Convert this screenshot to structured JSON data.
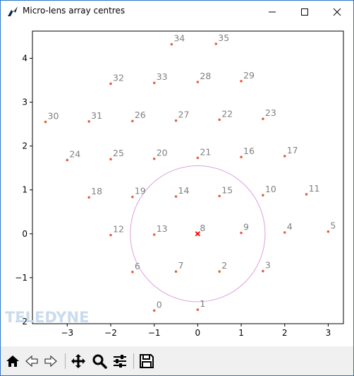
{
  "window": {
    "title": "Micro-lens array centres",
    "controls": [
      "minimize",
      "maximize",
      "close"
    ]
  },
  "watermark": "TELEDYNE",
  "toolbar": {
    "tools": [
      "home-icon",
      "back-arrow-icon",
      "forward-arrow-icon",
      "pan-icon",
      "zoom-icon",
      "configure-subplots-icon",
      "save-icon"
    ]
  },
  "colors": {
    "points": "#e8603c",
    "labels": "#808080",
    "circle": "#dda0dd",
    "centre_marker": "#ff0000"
  },
  "chart_data": {
    "type": "scatter",
    "title": "",
    "xlabel": "",
    "ylabel": "",
    "xlim": [
      -3.8,
      3.35
    ],
    "ylim": [
      -2.05,
      4.62
    ],
    "xticks": [
      -3,
      -2,
      -1,
      0,
      1,
      2,
      3
    ],
    "yticks": [
      -2,
      -1,
      0,
      1,
      2,
      3,
      4
    ],
    "grid": false,
    "points": [
      {
        "label": "0",
        "x": -1.0,
        "y": -1.75
      },
      {
        "label": "1",
        "x": 0.0,
        "y": -1.73
      },
      {
        "label": "2",
        "x": 0.5,
        "y": -0.86
      },
      {
        "label": "3",
        "x": 1.5,
        "y": -0.85
      },
      {
        "label": "4",
        "x": 2.0,
        "y": 0.03
      },
      {
        "label": "5",
        "x": 3.0,
        "y": 0.05
      },
      {
        "label": "6",
        "x": -1.5,
        "y": -0.87
      },
      {
        "label": "7",
        "x": -0.5,
        "y": -0.86
      },
      {
        "label": "8",
        "x": 0.0,
        "y": 0.0
      },
      {
        "label": "9",
        "x": 1.0,
        "y": 0.02
      },
      {
        "label": "10",
        "x": 1.5,
        "y": 0.88
      },
      {
        "label": "11",
        "x": 2.5,
        "y": 0.9
      },
      {
        "label": "12",
        "x": -2.0,
        "y": -0.03
      },
      {
        "label": "13",
        "x": -1.0,
        "y": -0.02
      },
      {
        "label": "14",
        "x": -0.5,
        "y": 0.85
      },
      {
        "label": "15",
        "x": 0.5,
        "y": 0.86
      },
      {
        "label": "16",
        "x": 1.0,
        "y": 1.75
      },
      {
        "label": "17",
        "x": 2.0,
        "y": 1.77
      },
      {
        "label": "18",
        "x": -2.5,
        "y": 0.83
      },
      {
        "label": "19",
        "x": -1.5,
        "y": 0.84
      },
      {
        "label": "20",
        "x": -1.0,
        "y": 1.71
      },
      {
        "label": "21",
        "x": 0.0,
        "y": 1.73
      },
      {
        "label": "22",
        "x": 0.5,
        "y": 2.6
      },
      {
        "label": "23",
        "x": 1.5,
        "y": 2.62
      },
      {
        "label": "24",
        "x": -3.0,
        "y": 1.68
      },
      {
        "label": "25",
        "x": -2.0,
        "y": 1.7
      },
      {
        "label": "26",
        "x": -1.5,
        "y": 2.57
      },
      {
        "label": "27",
        "x": -0.5,
        "y": 2.58
      },
      {
        "label": "28",
        "x": 0.0,
        "y": 3.46
      },
      {
        "label": "29",
        "x": 1.0,
        "y": 3.48
      },
      {
        "label": "30",
        "x": -3.5,
        "y": 2.55
      },
      {
        "label": "31",
        "x": -2.5,
        "y": 2.56
      },
      {
        "label": "32",
        "x": -2.0,
        "y": 3.42
      },
      {
        "label": "33",
        "x": -1.0,
        "y": 3.44
      },
      {
        "label": "34",
        "x": -0.6,
        "y": 4.32
      },
      {
        "label": "35",
        "x": 0.42,
        "y": 4.33
      }
    ],
    "circle": {
      "cx": 0.0,
      "cy": 0.0,
      "r": 1.55
    },
    "centre_marker": {
      "x": 0.0,
      "y": 0.0,
      "symbol": "x"
    }
  }
}
